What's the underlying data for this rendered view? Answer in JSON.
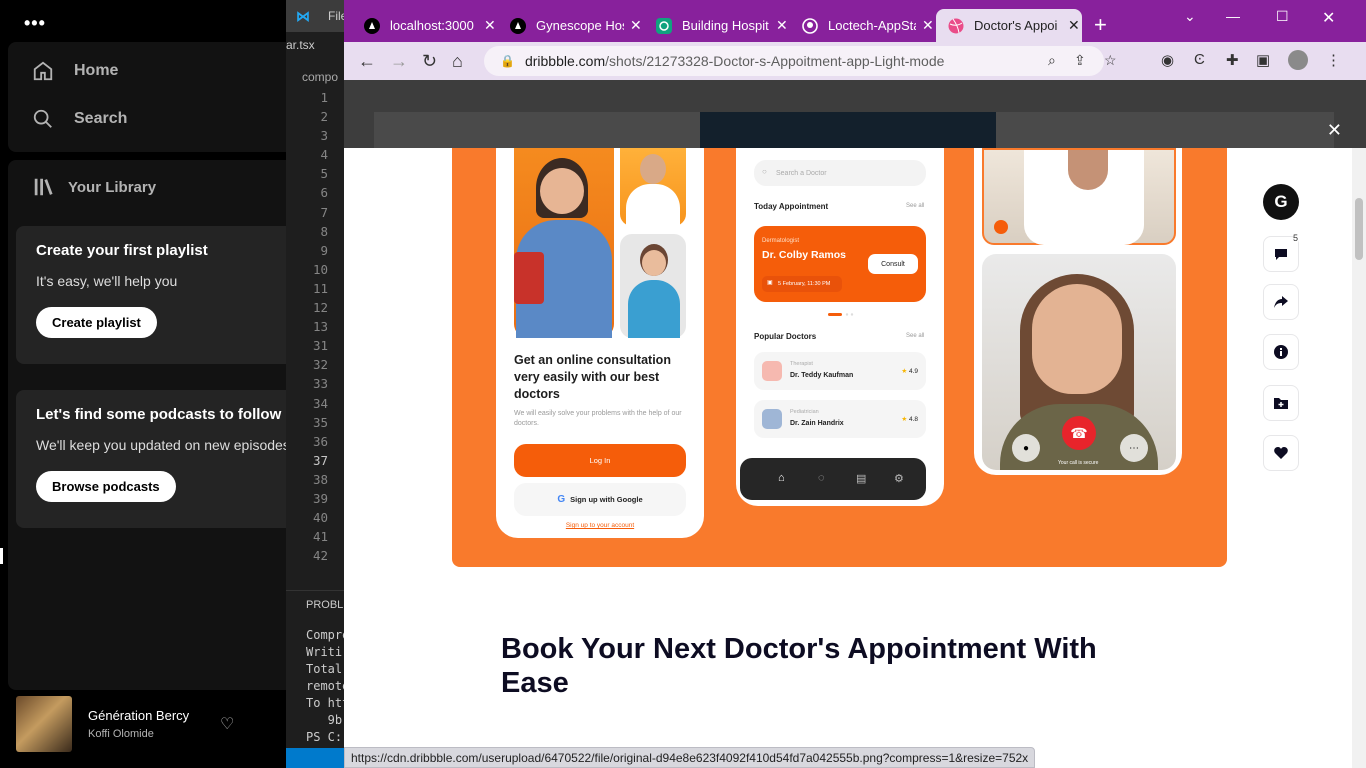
{
  "spotify": {
    "nav": {
      "home": "Home",
      "search": "Search"
    },
    "library": "Your Library",
    "playlist_card": {
      "title": "Create your first playlist",
      "subtitle": "It's easy, we'll help you",
      "button": "Create playlist"
    },
    "podcast_card": {
      "title": "Let's find some podcasts to follow",
      "subtitle": "We'll keep you updated on new episodes",
      "button": "Browse podcasts"
    },
    "now_playing": {
      "track": "Génération Bercy",
      "artist": "Koffi Olomide"
    }
  },
  "vscode": {
    "menu": "File",
    "tab": "ar.tsx",
    "crumb": "compo",
    "line_numbers": [
      "1",
      "2",
      "3",
      "4",
      "5",
      "6",
      "7",
      "8",
      "9",
      "10",
      "11",
      "12",
      "13",
      "31",
      "32",
      "33",
      "34",
      "35",
      "36",
      "37",
      "38",
      "39",
      "40",
      "41",
      "42"
    ],
    "current_line": "37",
    "panel_title": "PROBLE",
    "terminal": [
      "Compre",
      "Writi",
      "Total",
      "remote",
      "To htt",
      "   9b",
      "PS C:"
    ]
  },
  "chrome": {
    "tabs": [
      {
        "title": "localhost:3000",
        "icon": "nextjs-icon"
      },
      {
        "title": "Gynescope Hos",
        "icon": "nextjs-icon"
      },
      {
        "title": "Building Hospit",
        "icon": "chatgpt-icon"
      },
      {
        "title": "Loctech-AppSta",
        "icon": "github-icon"
      },
      {
        "title": "Doctor's Appoi",
        "icon": "dribbble-icon",
        "active": true
      }
    ],
    "url": {
      "host": "dribbble.com",
      "path": "/shots/21273328-Doctor-s-Appoitment-app-Light-mode"
    },
    "status_url": "https://cdn.dribbble.com/userupload/6470522/file/original-d94e8e623f4092f410d54fd7a042555b.png?compress=1&resize=752x",
    "colors": {
      "tabbar": "#88219c",
      "accent": "#f97a2c"
    }
  },
  "shot": {
    "title": "Book Your Next Doctor's Appointment With Ease",
    "comment_count": "5",
    "phone1": {
      "headline": "Get an online consultation very easily with our best doctors",
      "sub": "We will easily solve your problems with the help of our doctors.",
      "login": "Log In",
      "google": "Sign up with Google",
      "signup": "Sign up to your account"
    },
    "phone2": {
      "search": "Search a Doctor",
      "today": "Today Appointment",
      "see_all": "See all",
      "card_role": "Dermatologist",
      "card_doctor": "Dr. Colby Ramos",
      "consult": "Consult",
      "date": "5 February, 11:30 PM",
      "popular": "Popular Doctors",
      "doctors": [
        {
          "role": "Therapist",
          "name": "Dr. Teddy Kaufman",
          "rating": "4.9"
        },
        {
          "role": "Pediatrician",
          "name": "Dr. Zain Handrix",
          "rating": "4.8"
        }
      ]
    },
    "phone3": {
      "secure": "Your call is secure"
    }
  }
}
